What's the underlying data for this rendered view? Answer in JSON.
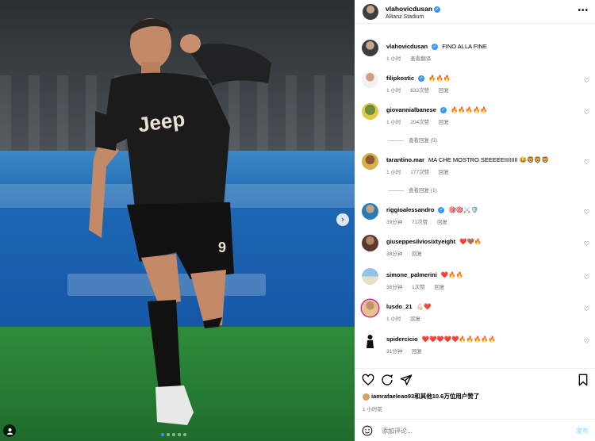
{
  "post": {
    "username": "vlahovicdusan",
    "location": "Allianz Stadium",
    "caption": "FINO ALLA FINE",
    "caption_time": "1 小时",
    "caption_translate": "查看翻译",
    "likes_text": "iamrafaeleao93和其他10.6万位用户赞了",
    "post_time": "1 小时前",
    "carousel_count": 5,
    "carousel_active": 1
  },
  "comments": [
    {
      "user": "filipkostic",
      "verified": true,
      "text": "🔥🔥🔥",
      "time": "1 小时",
      "likes": "633次赞",
      "reply": "回复"
    },
    {
      "user": "giovannialbanese",
      "verified": true,
      "text": "🔥🔥🔥🔥🔥",
      "time": "1 小时",
      "likes": "204次赞",
      "reply": "回复",
      "view_replies": "查看回复 (5)"
    },
    {
      "user": "tarantino.mar",
      "verified": false,
      "text": "MA CHE MOSTRO SEEEEEIIIIIIII 😂🦁🦁🦁",
      "time": "1 小时",
      "likes": "177次赞",
      "reply": "回复",
      "view_replies": "查看回复 (1)"
    },
    {
      "user": "riggioalessandro",
      "verified": true,
      "text": "🎯🎯⚔️🛡️",
      "time": "39分钟",
      "likes": "71次赞",
      "reply": "回复"
    },
    {
      "user": "giuseppesilviosixtyeight",
      "verified": false,
      "text": "❤️🤎🔥",
      "time": "38分钟",
      "likes": "",
      "reply": "回复"
    },
    {
      "user": "simone_palmerini",
      "verified": false,
      "text": "❤️🔥🔥",
      "time": "38分钟",
      "likes": "1次赞",
      "reply": "回复"
    },
    {
      "user": "lusdo_21",
      "verified": false,
      "text": "💪🏻❤️",
      "time": "1 小时",
      "likes": "",
      "reply": "回复"
    },
    {
      "user": "spidercicio",
      "verified": false,
      "text": "❤️❤️❤️❤️❤️🔥🔥🔥🔥🔥",
      "time": "31分钟",
      "likes": "",
      "reply": "回复"
    }
  ],
  "composer": {
    "placeholder": "添加评论...",
    "post_label": "发布"
  },
  "icons": {
    "header_more": "more-icon",
    "like": "heart-icon",
    "comment": "comment-icon",
    "share": "share-icon",
    "save": "bookmark-icon",
    "emoji": "emoji-icon",
    "carousel_next": "chevron-right-icon",
    "tags": "user-tag-icon"
  },
  "colors": {
    "verified": "#3897f0",
    "muted": "#737373",
    "jersey": "#1a1a1a",
    "pitch": "#2a8237",
    "board": "#1d67b3"
  }
}
